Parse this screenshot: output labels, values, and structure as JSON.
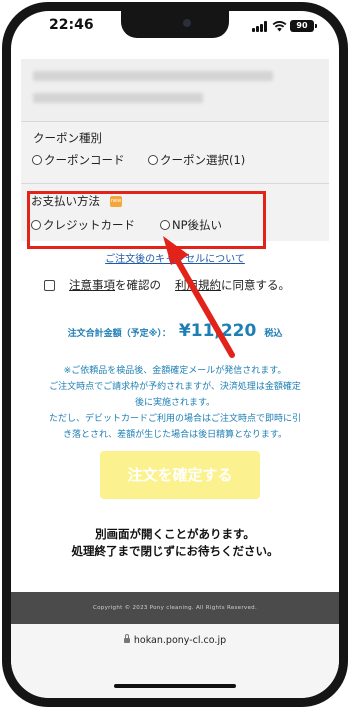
{
  "status_bar": {
    "time": "22:46",
    "battery": "90"
  },
  "coupon": {
    "title": "クーポン種別",
    "options": [
      "クーポンコード",
      "クーポン選択(1)"
    ]
  },
  "payment": {
    "title": "お支払い方法",
    "badge": "new",
    "options": [
      "クレジットカード",
      "NP後払い"
    ]
  },
  "cancel_link": "ご注文後のキャンセルについて",
  "agreement": {
    "link1": "注意事項",
    "mid1": "を確認の",
    "mid2": "利用規約",
    "end": "に同意する。"
  },
  "total": {
    "label": "注文合計金額（予定※）：",
    "amount": "¥11,220",
    "tax": "税込"
  },
  "notice_lines": [
    "※ご依頼品を検品後、金額確定メールが発信されます。",
    "ご注文時点でご請求枠が予約されますが、決済処理は金額確定",
    "後に実施されます。",
    "ただし、デビットカードご利用の場合はご注文時点で即時に引",
    "き落とされ、差額が生じた場合は後日精算となります。"
  ],
  "confirm_button": "注文を確定する",
  "window_note": [
    "別画面が開くことがあります。",
    "処理終了まで閉じずにお待ちください。"
  ],
  "footer": "Copyright © 2023 Pony cleaning. All Rights Reserved.",
  "url": "hokan.pony-cl.co.jp",
  "colors": {
    "highlight": "#e2231a",
    "accent_blue": "#1e7fb4",
    "button": "#fbf18f"
  }
}
